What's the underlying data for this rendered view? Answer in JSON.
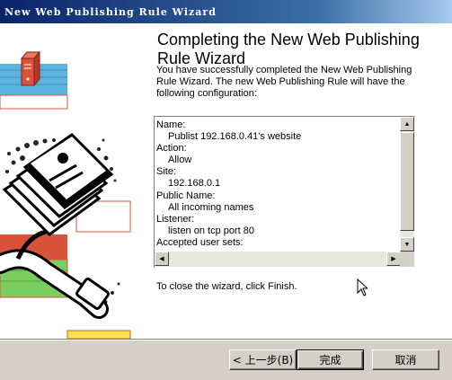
{
  "window": {
    "title": "New Web Publishing Rule Wizard"
  },
  "heading": "Completing the New Web Publishing Rule Wizard",
  "intro": "You have successfully completed the New Web Publishing Rule Wizard. The new Web Publishing Rule will have the following configuration:",
  "config": [
    {
      "label": "Name:",
      "value": "Publist 192.168.0.41's website"
    },
    {
      "label": "Action:",
      "value": "Allow"
    },
    {
      "label": "Site:",
      "value": "192.168.0.1"
    },
    {
      "label": "Public Name:",
      "value": "All incoming names"
    },
    {
      "label": "Listener:",
      "value": "listen on tcp port 80"
    },
    {
      "label": "Accepted user sets:",
      "value": ""
    }
  ],
  "finish_text": "To close the wizard, click Finish.",
  "buttons": {
    "back": "< 上一步(B)",
    "finish": "完成",
    "cancel": "取消"
  },
  "colors": {
    "titlebar": "#0a246a",
    "dialog_face": "#d4d0c8",
    "accent_red": "#d9533a",
    "accent_blue": "#5ab4dc",
    "accent_green": "#7ccc5e",
    "accent_yellow": "#f4e64a"
  },
  "icons": [
    "server-icon",
    "network-cable-plug-icon",
    "document-icon",
    "scroll-up-icon",
    "scroll-down-icon",
    "scroll-left-icon",
    "scroll-right-icon",
    "mouse-cursor-icon"
  ]
}
